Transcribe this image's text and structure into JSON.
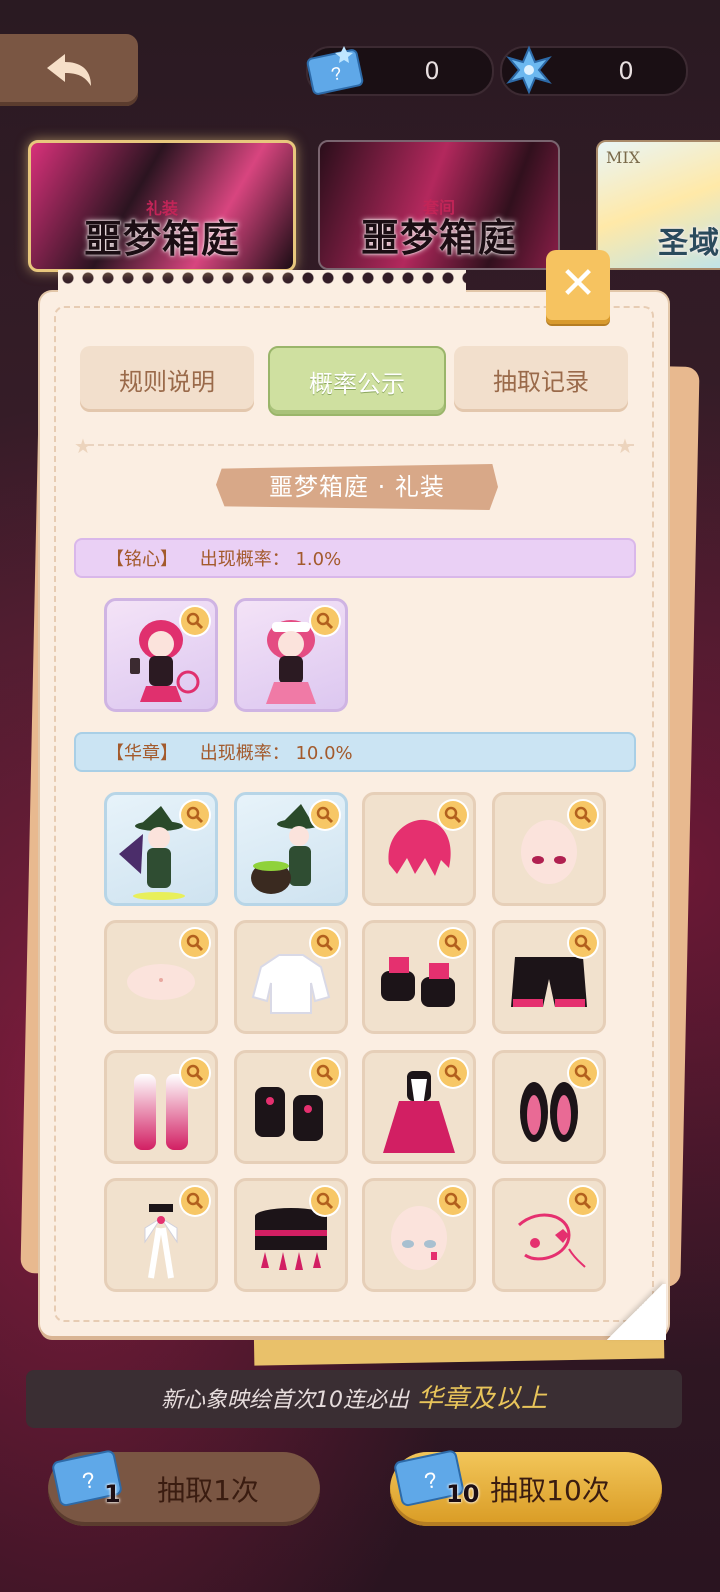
{
  "currency": {
    "ticket_value": "0",
    "crystal_value": "0"
  },
  "banners": [
    {
      "tag": "礼装",
      "title": "噩梦箱庭"
    },
    {
      "tag": "套间",
      "title": "噩梦箱庭"
    },
    {
      "tag": "MIX",
      "title": "圣域"
    }
  ],
  "tabs": {
    "rules": "规则说明",
    "probability": "概率公示",
    "record": "抽取记录"
  },
  "section_title": "噩梦箱庭 · 礼装",
  "rarity_groups": [
    {
      "name": "【铭心】",
      "rate_label": "出现概率：",
      "rate": "1.0%",
      "items": [
        "铭心礼装A",
        "铭心礼装B"
      ]
    },
    {
      "name": "【华章】",
      "rate_label": "出现概率：",
      "rate": "10.0%",
      "items": [
        "华章礼装A",
        "华章礼装B",
        "发型",
        "脸型",
        "肤色",
        "上衣",
        "手套",
        "裤装",
        "袜子",
        "鞋子",
        "连衣裙",
        "耳饰",
        "发饰",
        "腰饰",
        "脸饰",
        "饰品"
      ]
    }
  ],
  "notice": {
    "text": "新心象映绘首次10连必出",
    "highlight": "华章及以上"
  },
  "draw_buttons": {
    "single_count": "1",
    "single_label": "抽取1次",
    "ten_count": "10",
    "ten_label": "抽取10次"
  },
  "colors": {
    "accent_gold": "#f6c360",
    "tab_active": "#cfe0a0",
    "rarity_purple": "#ead0f5",
    "rarity_blue": "#cbe4f3",
    "notice_highlight": "#e8c45a"
  }
}
